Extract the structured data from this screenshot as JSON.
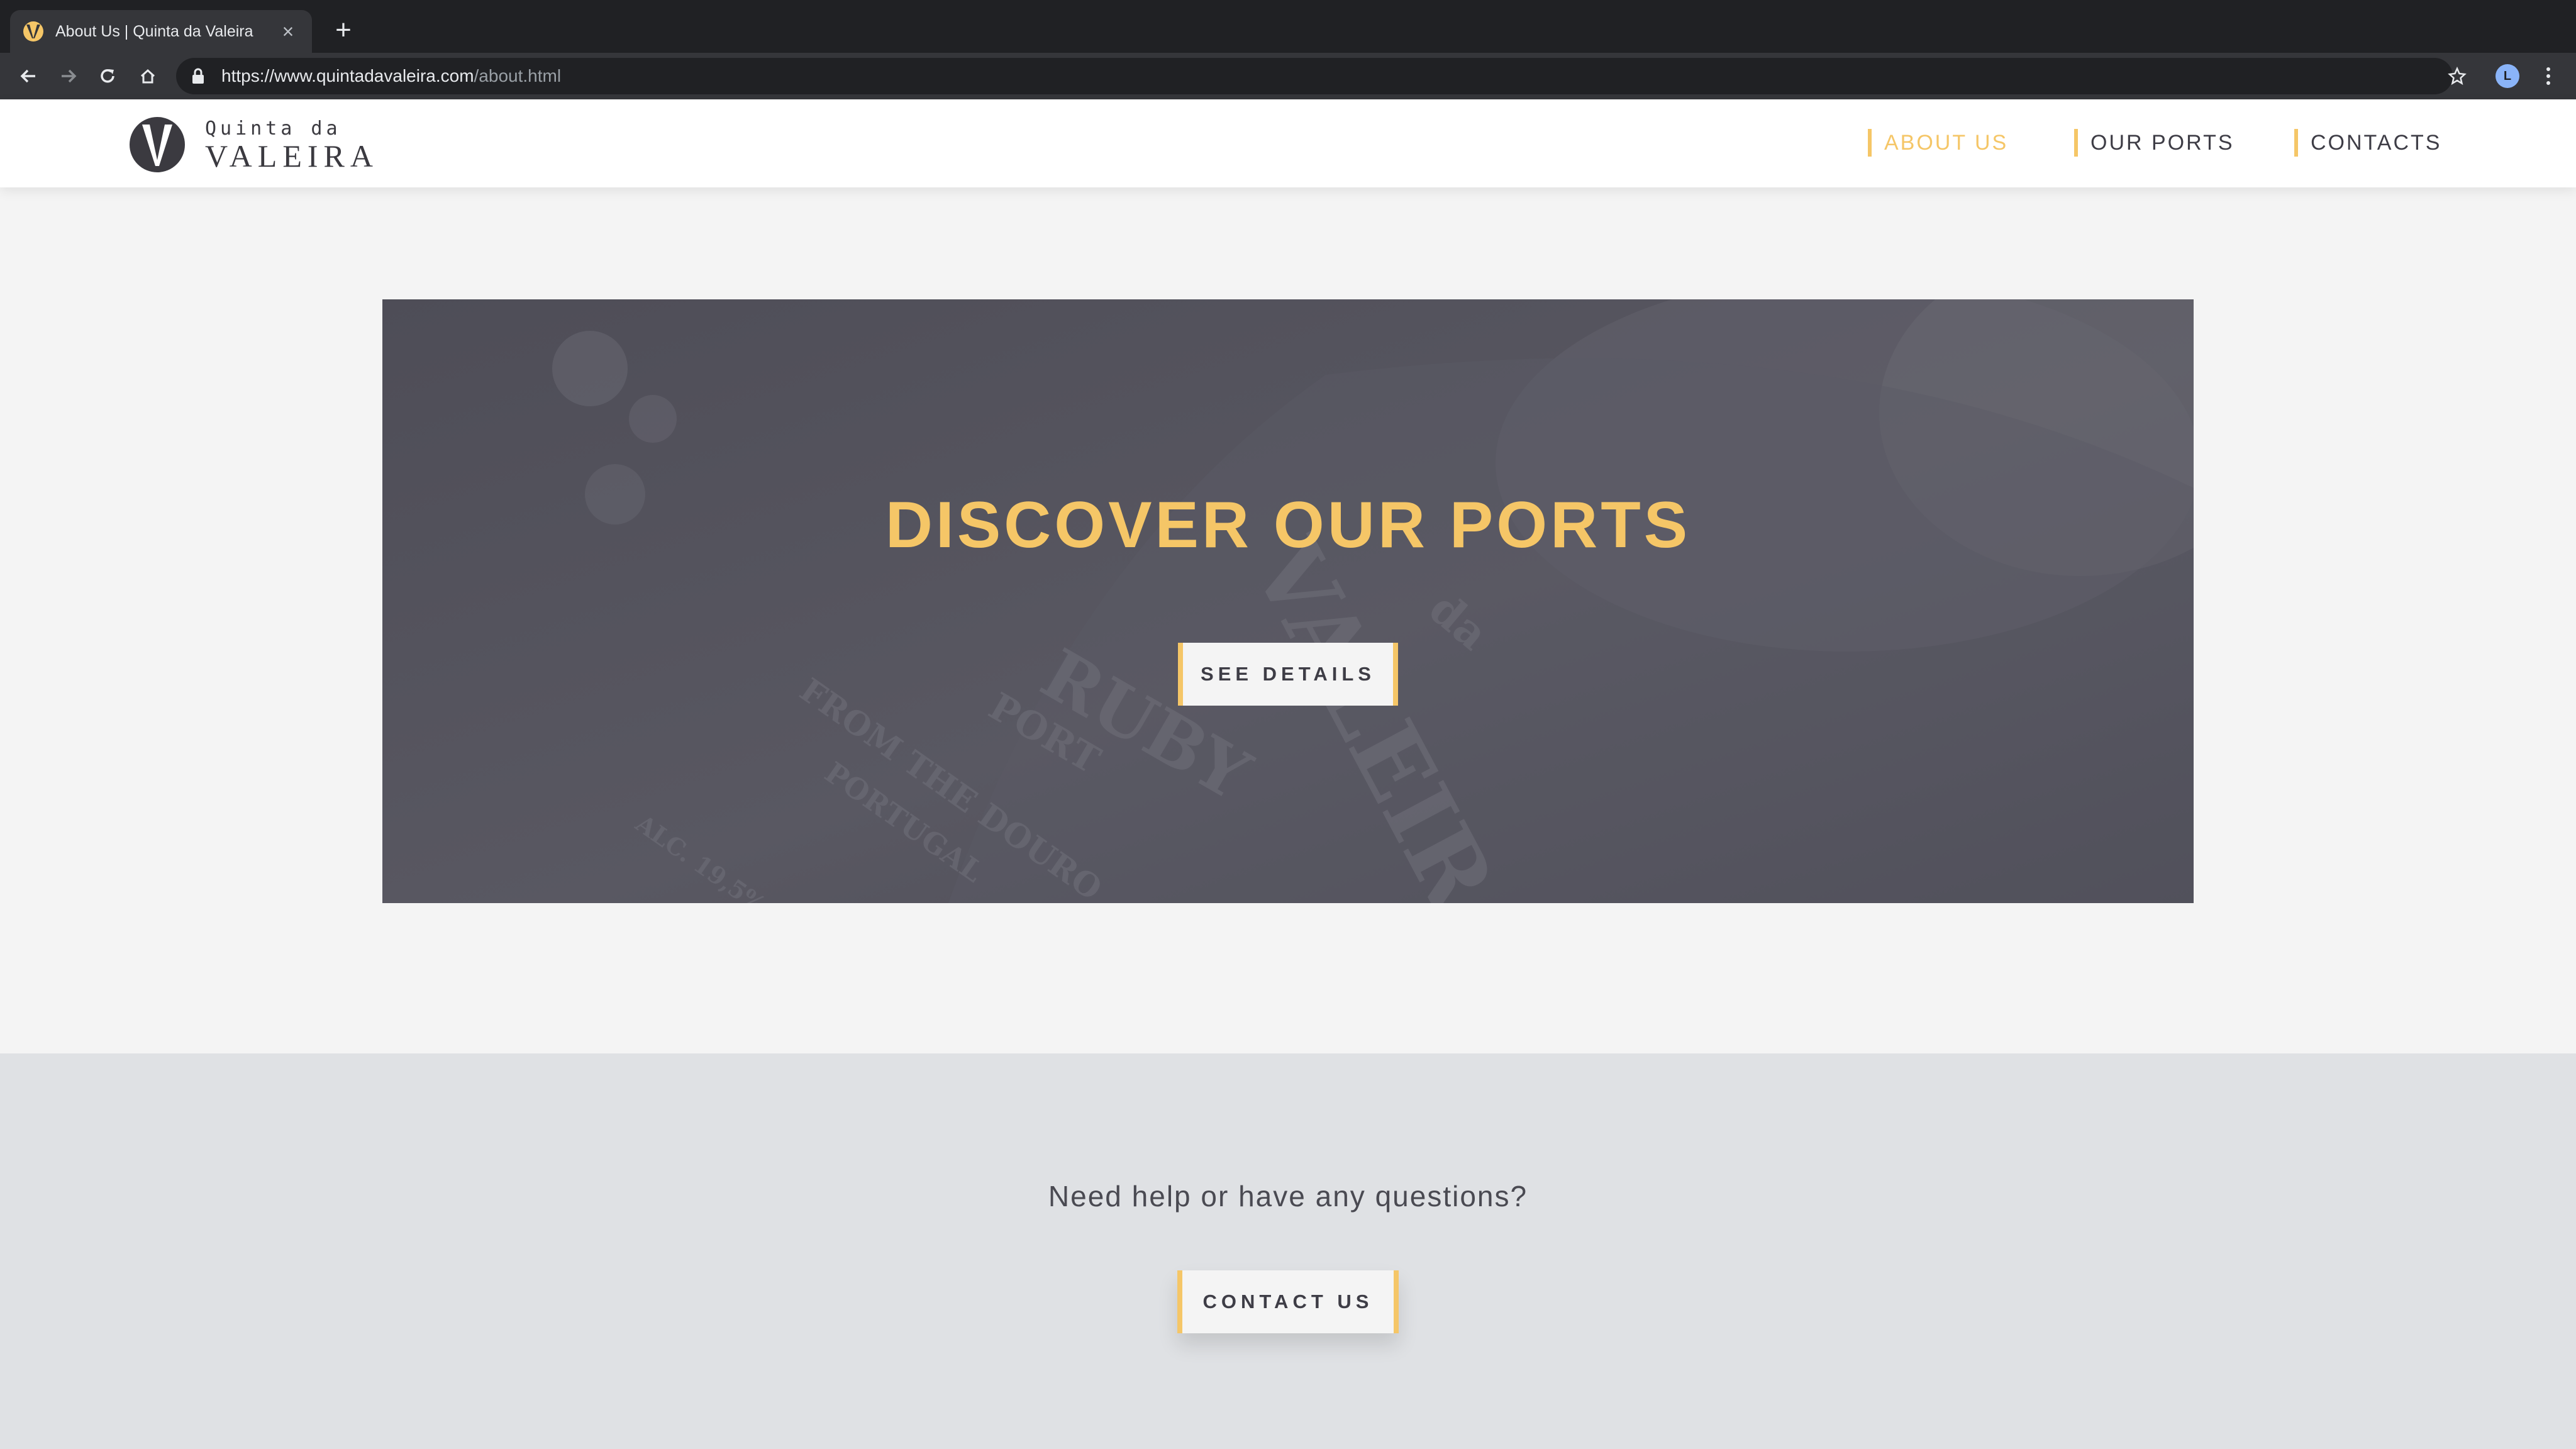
{
  "browser": {
    "tab_title": "About Us | Quinta da Valeira",
    "tab_close": "×",
    "new_tab": "+",
    "url_host": "https://www.quintadavaleira.com",
    "url_path": "/about.html",
    "profile_initial": "L"
  },
  "site": {
    "logo_top": "Quinta da",
    "logo_main": "VALEIRA",
    "nav": [
      {
        "label": "ABOUT US",
        "active": true
      },
      {
        "label": "OUR PORTS",
        "active": false
      },
      {
        "label": "CONTACTS",
        "active": false
      }
    ],
    "accent_color": "#f5c667",
    "text_color": "#3e3d46"
  },
  "hero": {
    "title": "DISCOVER OUR PORTS",
    "button": "SEE DETAILS",
    "bottle_label": [
      "RUBY",
      "PORT",
      "VALEIRA",
      "da",
      "FROM THE DOURO",
      "PORTUGAL",
      "ALC. 19,5%"
    ]
  },
  "contact": {
    "question": "Need help or have any questions?",
    "button": "CONTACT US"
  }
}
